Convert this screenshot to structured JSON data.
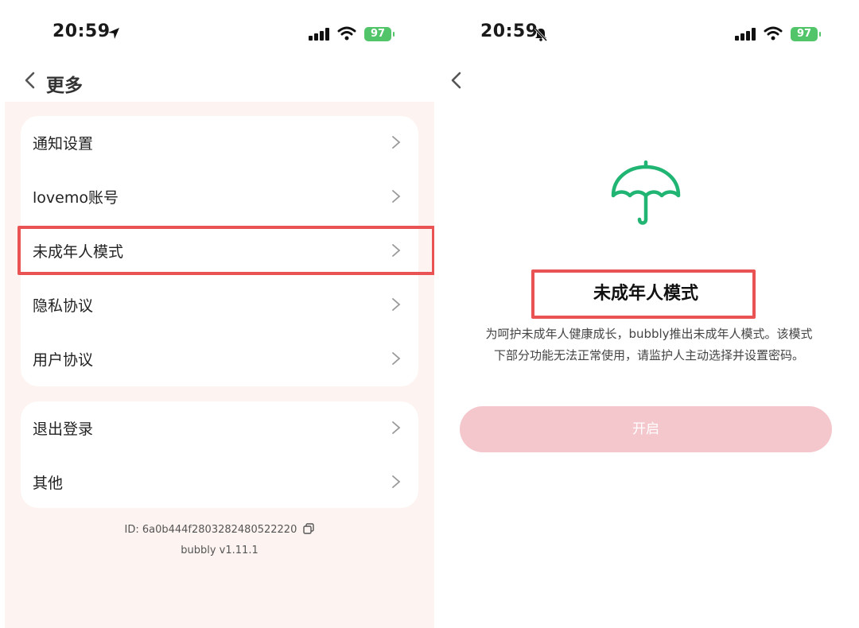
{
  "left": {
    "status": {
      "time": "20:59",
      "battery": "97"
    },
    "nav": {
      "title": "更多"
    },
    "group1": [
      {
        "label": "通知设置"
      },
      {
        "label": "lovemo账号"
      },
      {
        "label": "未成年人模式"
      },
      {
        "label": "隐私协议"
      },
      {
        "label": "用户协议"
      }
    ],
    "group2": [
      {
        "label": "退出登录"
      },
      {
        "label": "其他"
      }
    ],
    "footer": {
      "id_text": "ID: 6a0b444f2803282480522220",
      "version": "bubbly v1.11.1"
    }
  },
  "right": {
    "status": {
      "time": "20:59",
      "battery": "97"
    },
    "title": "未成年人模式",
    "description_line1": "为呵护未成年人健康成长，bubbly推出未成年人模式。该模式",
    "description_line2": "下部分功能无法正常使用，请监护人主动选择并设置密码。",
    "button_label": "开启"
  },
  "colors": {
    "accent_green": "#21b573",
    "highlight_red": "#ea5354",
    "button_pink": "#f4c7cc",
    "page_pink": "#fdf3f1",
    "battery_green": "#52c46a"
  },
  "icons": [
    "location-arrow-icon",
    "bell-muted-icon",
    "cellular-signal-icon",
    "wifi-icon",
    "battery-icon",
    "back-chevron-icon",
    "chevron-right-icon",
    "copy-icon",
    "umbrella-icon"
  ]
}
